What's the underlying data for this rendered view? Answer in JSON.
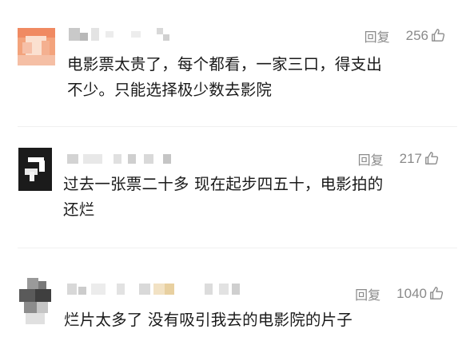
{
  "comments": [
    {
      "reply_label": "回复",
      "likes": "256",
      "text_lines": [
        "电影票太贵了，每个都看，一家三口，得支出",
        "不少。只能选择极少数去影院"
      ]
    },
    {
      "reply_label": "回复",
      "likes": "217",
      "text_lines": [
        "过去一张票二十多 现在起步四五十，电影拍的",
        "还烂"
      ]
    },
    {
      "reply_label": "回复",
      "likes": "1040",
      "text_lines": [
        "烂片太多了 没有吸引我去的电影院的片子"
      ]
    }
  ],
  "icons": {
    "like": "thumbs-up-icon"
  },
  "colors": {
    "meta_text": "#8a8a8a",
    "body_text": "#1a1a1a"
  }
}
